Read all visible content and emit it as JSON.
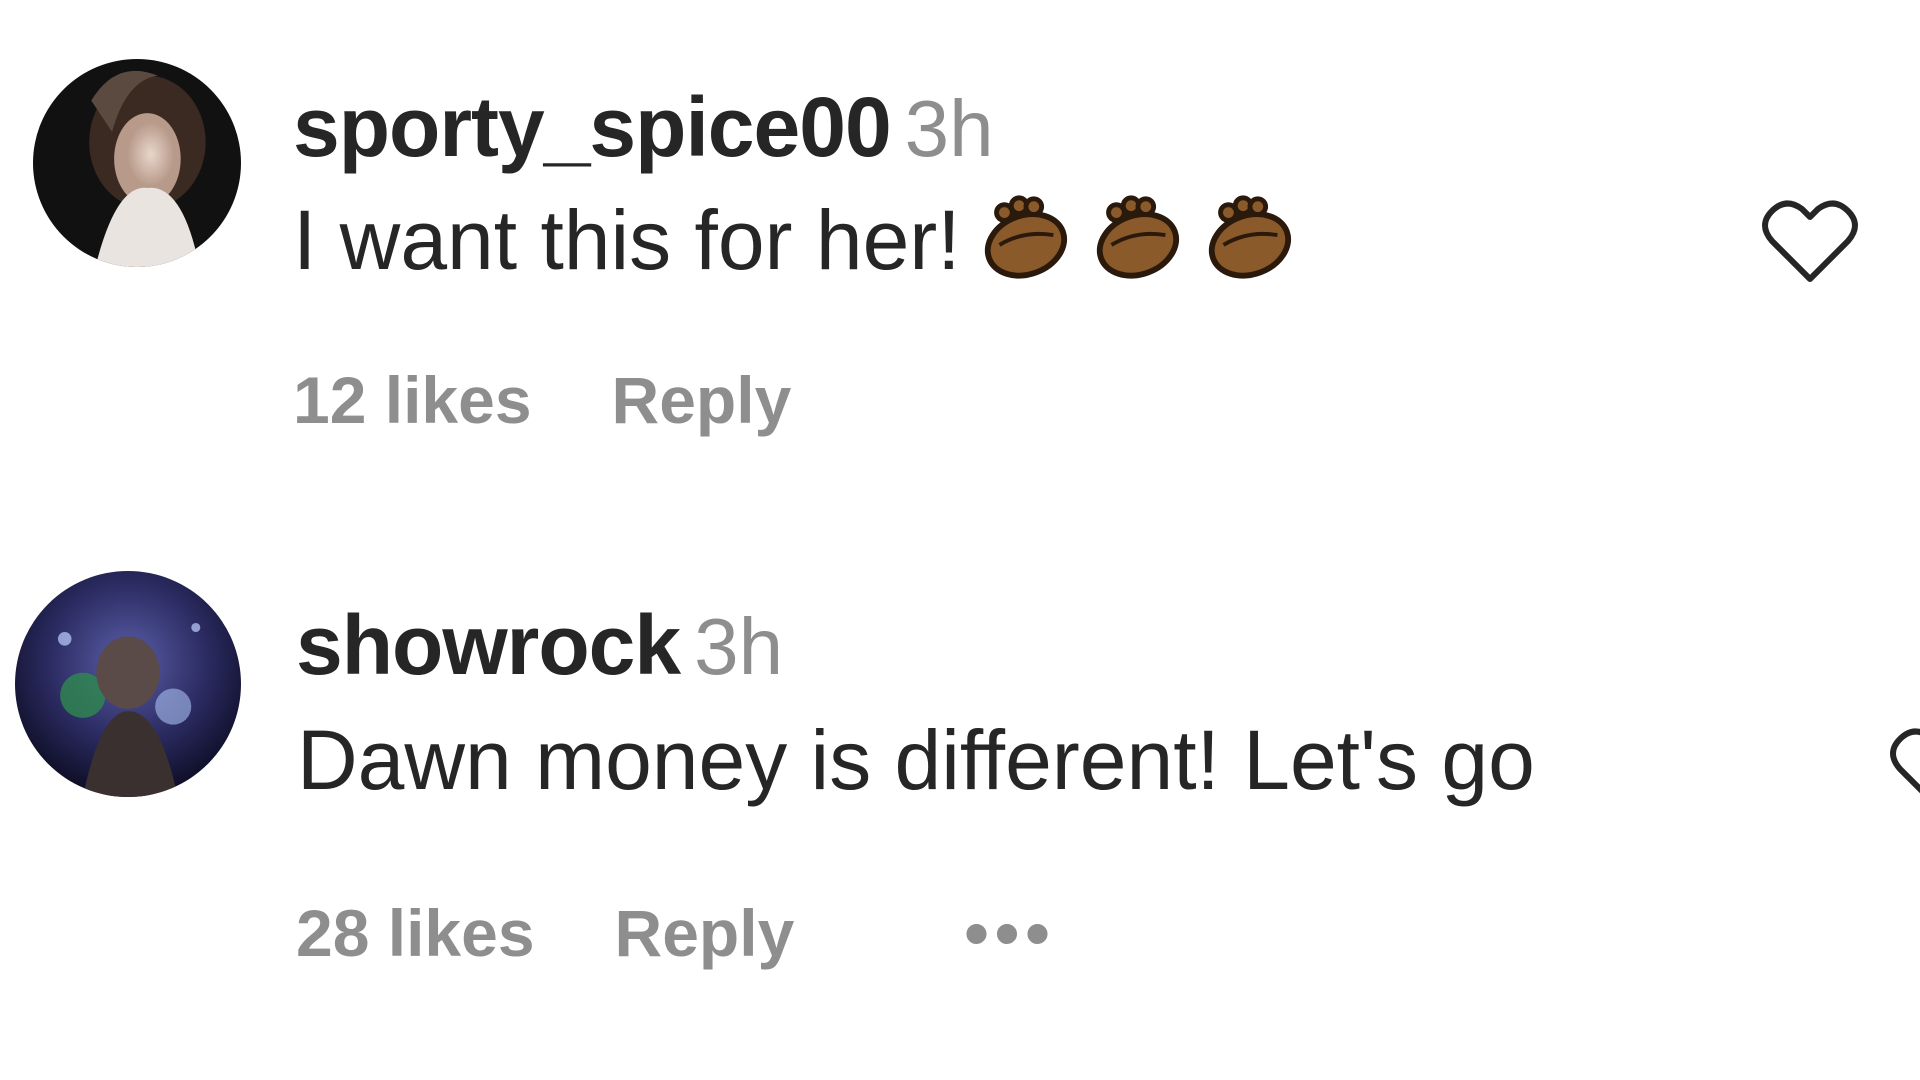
{
  "comments": [
    {
      "username": "sporty_spice00",
      "time": "3h",
      "text": "I want this for her!",
      "emojis": [
        "clapping-hands-emoji",
        "clapping-hands-emoji",
        "clapping-hands-emoji"
      ],
      "likes": "12 likes",
      "reply_label": "Reply"
    },
    {
      "username": "showrock",
      "time": "3h",
      "text": "Dawn money is different! Let's go",
      "emojis": [],
      "likes": "28 likes",
      "reply_label": "Reply",
      "more_label": "•••"
    }
  ],
  "colors": {
    "primary_text": "#262626",
    "secondary_text": "#8e8e8e",
    "emoji_skin": "#8b5a2b"
  },
  "icons": {
    "like": "heart-outline-icon"
  }
}
